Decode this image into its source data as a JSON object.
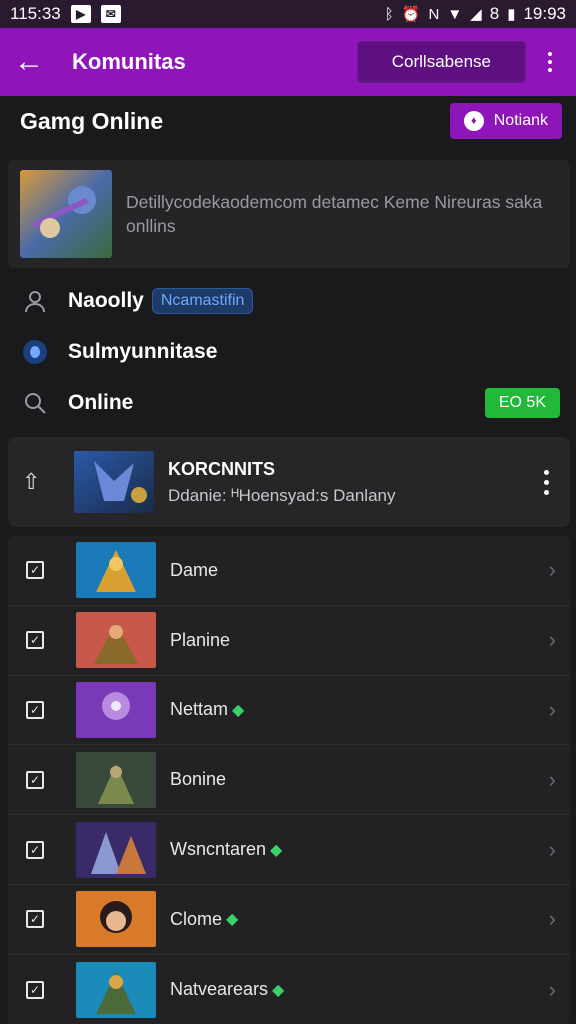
{
  "status_bar": {
    "time": "115:33",
    "clock": "19:93",
    "battery_text": "8"
  },
  "app_bar": {
    "back_icon": "arrow-left-icon",
    "title": "Komunitas",
    "action_button": "Corllsabense"
  },
  "header": {
    "title": "Gamg Online",
    "action_button": "Notiank"
  },
  "description": {
    "text": "Detillycodekaodemcom detamec Keme Nireuras saka onllins"
  },
  "info_rows": [
    {
      "icon": "person-icon",
      "label": "Naoolly",
      "chip": "Ncamastifin"
    },
    {
      "icon": "community-icon",
      "label": "Sulmyunnitase"
    },
    {
      "icon": "search-icon",
      "label": "Online",
      "badge": "EO 5K"
    }
  ],
  "community": {
    "name": "KORCNNITS",
    "subtitle": "Ddanie: ᴴHoensyad:s Danlany"
  },
  "list": [
    {
      "label": "Dame",
      "gem": false
    },
    {
      "label": "Planine",
      "gem": false
    },
    {
      "label": "Nettam",
      "gem": true
    },
    {
      "label": "Bonine",
      "gem": false
    },
    {
      "label": "Wsncntaren",
      "gem": true
    },
    {
      "label": "Clome",
      "gem": true
    },
    {
      "label": "Natvearears",
      "gem": true
    }
  ],
  "colors": {
    "accent": "#8e16b8",
    "background": "#1a1a1c",
    "badge_green": "#22b83a",
    "chip_blue": "#1e3a66"
  }
}
